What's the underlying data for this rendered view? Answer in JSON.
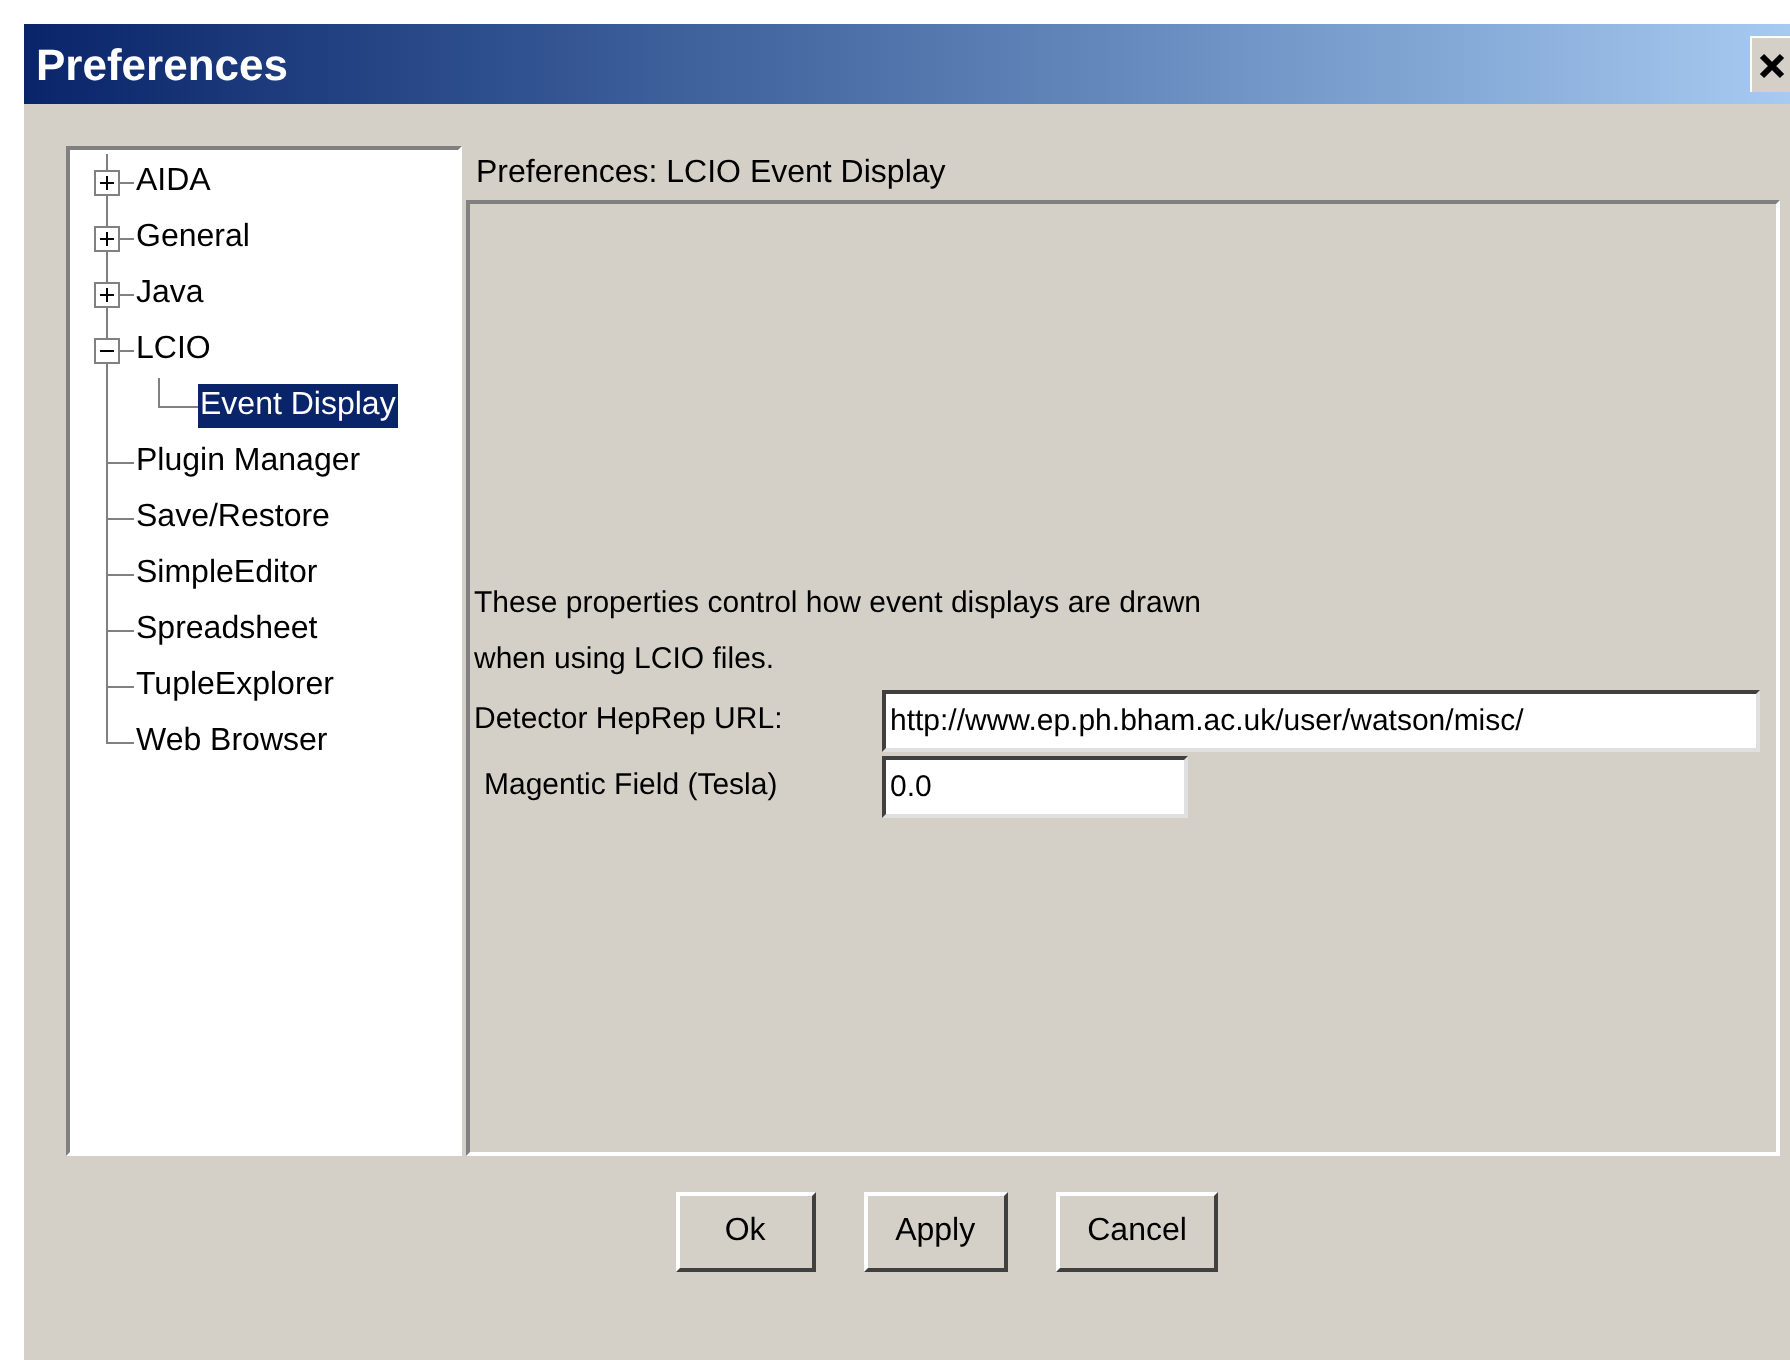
{
  "window": {
    "title": "Preferences"
  },
  "tree": [
    {
      "label": "AIDA",
      "kind": "folder",
      "expanded": false,
      "selected": false
    },
    {
      "label": "General",
      "kind": "folder",
      "expanded": false,
      "selected": false
    },
    {
      "label": "Java",
      "kind": "folder",
      "expanded": false,
      "selected": false
    },
    {
      "label": "LCIO",
      "kind": "folder",
      "expanded": true,
      "selected": false,
      "children": [
        {
          "label": "Event Display",
          "selected": true
        }
      ]
    },
    {
      "label": "Plugin Manager",
      "kind": "leaf",
      "selected": false
    },
    {
      "label": "Save/Restore",
      "kind": "leaf",
      "selected": false
    },
    {
      "label": "SimpleEditor",
      "kind": "leaf",
      "selected": false
    },
    {
      "label": "Spreadsheet",
      "kind": "leaf",
      "selected": false
    },
    {
      "label": "TupleExplorer",
      "kind": "leaf",
      "selected": false
    },
    {
      "label": "Web Browser",
      "kind": "leaf",
      "selected": false
    }
  ],
  "panel": {
    "heading": "Preferences: LCIO Event Display",
    "description": "These properties control how event displays are drawn\nwhen using LCIO files.",
    "fields": [
      {
        "label": "Detector HepRep URL:",
        "value": "http://www.ep.ph.bham.ac.uk/user/watson/misc/"
      },
      {
        "label": "Magentic Field (Tesla)",
        "value": "0.0"
      }
    ]
  },
  "buttons": [
    "Ok",
    "Apply",
    "Cancel"
  ]
}
